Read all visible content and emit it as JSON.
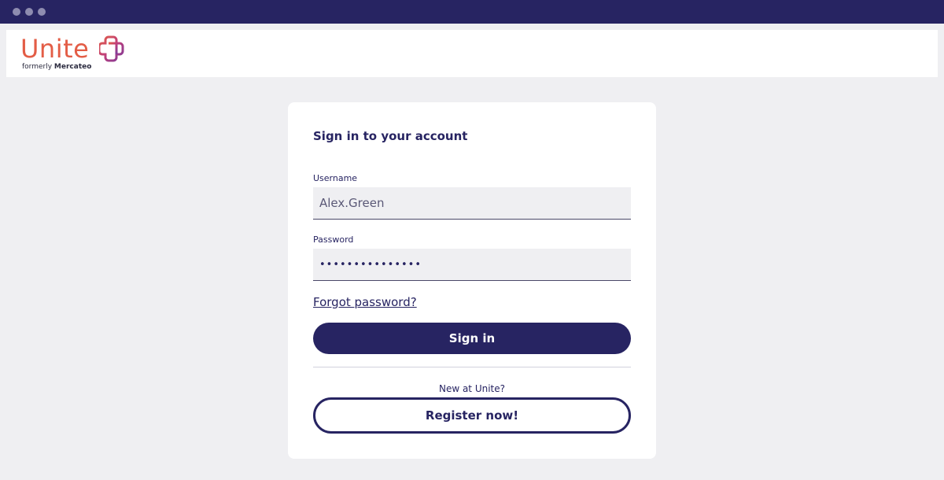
{
  "window": {
    "controls": [
      "dot-1",
      "dot-2",
      "dot-3"
    ]
  },
  "header": {
    "logo_word": "Unite",
    "logo_sub_prefix": "formerly ",
    "logo_sub_brand": "Mercateo",
    "brand_color": "#e35d46",
    "logo_icon": "unite-cross-icon"
  },
  "signin": {
    "title": "Sign in to your account",
    "username_label": "Username",
    "username_value": "Alex.Green",
    "password_label": "Password",
    "password_value": "•••••••••••••••",
    "forgot_link": "Forgot password?",
    "signin_button": "Sign in",
    "new_text": "New at Unite?",
    "register_button": "Register now!"
  },
  "colors": {
    "primary": "#272462",
    "background": "#efeff2",
    "accent": "#e35d46"
  }
}
